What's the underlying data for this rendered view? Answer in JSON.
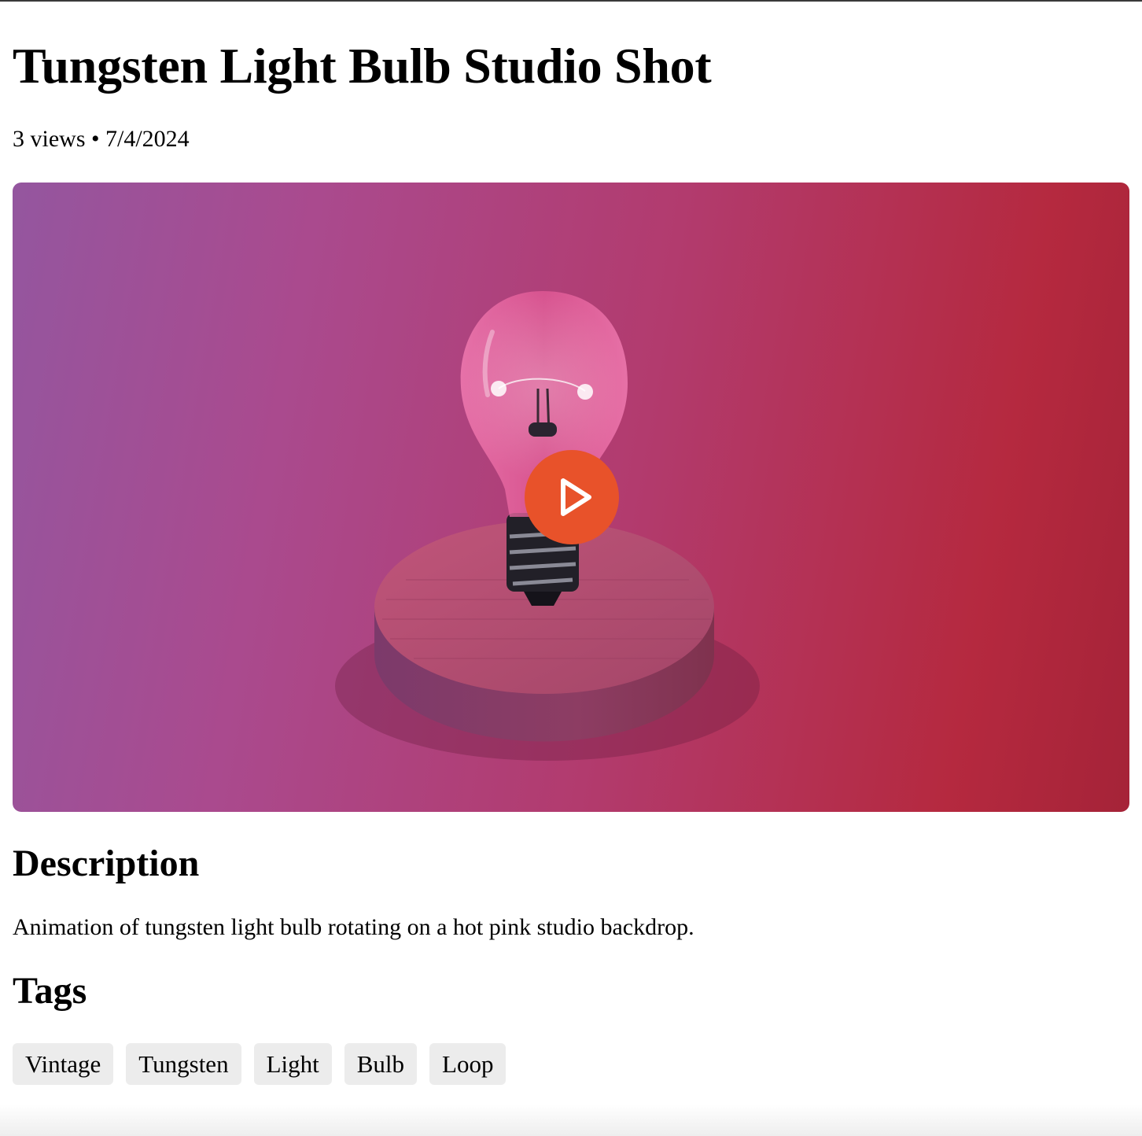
{
  "video": {
    "title": "Tungsten Light Bulb Studio Shot",
    "views": "3 views",
    "separator": "•",
    "date": "7/4/2024",
    "thumbnail_colors": {
      "left": "#94569f",
      "right": "#b5293f"
    },
    "play_button_color": "#e8522a"
  },
  "description": {
    "heading": "Description",
    "text": "Animation of tungsten light bulb rotating on a hot pink studio backdrop."
  },
  "tags": {
    "heading": "Tags",
    "items": [
      "Vintage",
      "Tungsten",
      "Light",
      "Bulb",
      "Loop"
    ]
  }
}
